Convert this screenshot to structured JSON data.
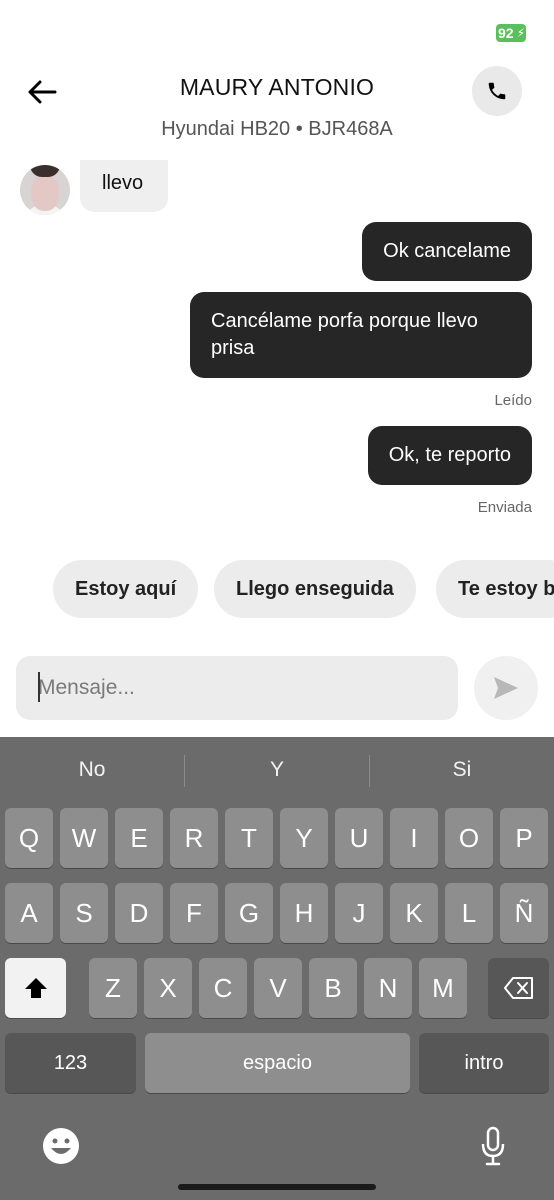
{
  "status_bar": {
    "battery": "92"
  },
  "header": {
    "driver_name": "MAURY ANTONIO",
    "vehicle": "Hyundai HB20 • BJR468A"
  },
  "messages": {
    "incoming_partial": "llevo",
    "outgoing": [
      {
        "text": "Ok cancelame"
      },
      {
        "text": "Cancélame porfa porque llevo prisa",
        "status": "Leído"
      },
      {
        "text": "Ok, te reporto",
        "status": "Enviada"
      }
    ]
  },
  "quick_replies": [
    "Estoy aquí",
    "Llego enseguida",
    "Te estoy b"
  ],
  "composer": {
    "placeholder": "Mensaje..."
  },
  "keyboard": {
    "suggestions": [
      "No",
      "Y",
      "Si"
    ],
    "row1": [
      "Q",
      "W",
      "E",
      "R",
      "T",
      "Y",
      "U",
      "I",
      "O",
      "P"
    ],
    "row2": [
      "A",
      "S",
      "D",
      "F",
      "G",
      "H",
      "J",
      "K",
      "L",
      "Ñ"
    ],
    "row3": [
      "Z",
      "X",
      "C",
      "V",
      "B",
      "N",
      "M"
    ],
    "numbers_key": "123",
    "space_key": "espacio",
    "return_key": "intro"
  }
}
